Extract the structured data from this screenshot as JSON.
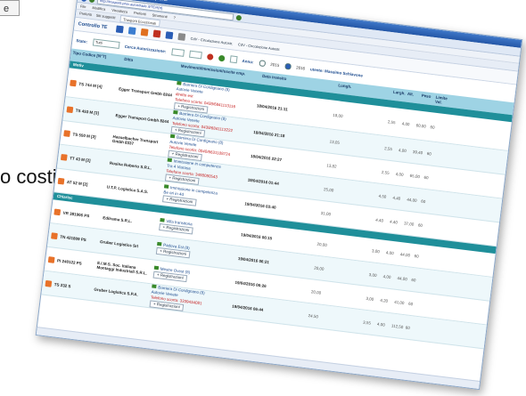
{
  "fragment": {
    "button_label": "e",
    "text": "o costituire"
  },
  "browser": {
    "title": "Trasporti Eccezionali - Internet Explorer",
    "address": "http://trasporti.prov.autostrade.it/TE/#{tr}",
    "menu": [
      "File",
      "Modifica",
      "Visualizza",
      "Preferiti",
      "Strumenti",
      "?"
    ],
    "favorites": [
      "Preferiti",
      "Siti suggeriti",
      "Trasporti Eccezionali"
    ],
    "tab": "Trasporti Eccezionali"
  },
  "app": {
    "title": "Controllo TE",
    "toolbar_links": [
      "CdV - Circolazione Autostr.",
      "CdV - Circolazione Autostr."
    ]
  },
  "filters": {
    "stato_label": "Stato:",
    "stato_value": "Tutti",
    "cerca_label": "Cerca Autorizzazione:",
    "anno_label": "Anno:",
    "anno_options": [
      "2015",
      "2016"
    ],
    "anno_selected": "2016",
    "user_label": "utente: Massimo Schiavone"
  },
  "table": {
    "headers": [
      "Tipo Codice [N°T]",
      "Ditta",
      "Movimenti/Immissioni/uscite cmp.",
      "Data transito",
      "Lungh.",
      "Largh.",
      "Alt.",
      "Peso",
      "Limite Vel."
    ],
    "sections": {
      "first": "Motiv",
      "second": "Chiarisc"
    },
    "rows": [
      {
        "code": "TS 744 M [4]",
        "ditta": "Egger Transport Gmbh 8244",
        "mov1": "Barriera Di Cordignano (8)",
        "mov2": "Autovie Venete",
        "mov3": "diretto est",
        "tel": "Telefono scorta: 0438/6841113116",
        "reg": "+ Registrazioni",
        "date": "18/04/2016 21:11",
        "l": "18,00",
        "w": "2,55",
        "h": "4,00",
        "p": "60,00",
        "v": "60"
      },
      {
        "code": "TS 453 M [3]",
        "ditta": "Egger Transport Gmbh 8244",
        "mov1": "Barriera Di Cordignano (8)",
        "mov2": "Autovie Venete",
        "mov3": "",
        "tel": "Telefono scorta: 0438/6841113222",
        "reg": "+ Registrazioni",
        "date": "18/04/2016 21:18",
        "l": "13,05",
        "w": "2,55",
        "h": "4,00",
        "p": "39,40",
        "v": "60"
      },
      {
        "code": "TS 550 M [2]",
        "ditta": "Hasselbacher Transport Gmbh 8337",
        "mov1": "Barriera Di Cordignano (8)",
        "mov2": "Autovie Venete",
        "mov3": "",
        "tel": "Telefono scorta: 0040/6631108724",
        "reg": "+ Registrazioni",
        "date": "18/04/2016 22:27",
        "l": "13,82",
        "w": "2,55",
        "h": "4,00",
        "p": "65,00",
        "v": "60"
      },
      {
        "code": "TT 43 M [2]",
        "ditta": "Rosina Roberto S.R.L.",
        "mov1": "Immissione in competenza",
        "mov2": "Tra 4 Viarasa",
        "mov3": "",
        "tel": "Telefono scorta: 3498080543",
        "reg": "+ Registrazioni",
        "date": "19/04/2016 01:44",
        "l": "25,00",
        "w": "4,50",
        "h": "4,40",
        "p": "44,00",
        "v": "60"
      },
      {
        "code": "AT 52 M [2]",
        "ditta": "U.T.P. Logistica S.A.S.",
        "mov1": "Immissione in competenza",
        "mov2": "Be ori in 4d",
        "mov3": "",
        "tel": "",
        "reg": "+ Registrazioni",
        "date": "19/04/2016 03:40",
        "l": "31,00",
        "w": "4,40",
        "h": "4,40",
        "p": "37,00",
        "v": "60"
      }
    ],
    "rows2": [
      {
        "code": "VR 381906 PS",
        "ditta": "Edilrama S.R.L.",
        "mov1": "Villa transitoria",
        "mov2": "",
        "tel": "",
        "reg": "+ Registrazioni",
        "date": "19/04/2016 06:15",
        "l": "20,00",
        "w": "3,00",
        "h": "4,00",
        "p": "44,00",
        "v": "60"
      },
      {
        "code": "TN 421809 PS",
        "ditta": "Gruber Logistics Srl",
        "mov1": "Padova Est (8)",
        "mov2": "",
        "tel": "",
        "reg": "+ Registrazioni",
        "date": "19/04/2016 06:21",
        "l": "20,00",
        "w": "3,00",
        "h": "4,00",
        "p": "44,00",
        "v": "60"
      },
      {
        "code": "PI 240122 PS",
        "ditta": "E.I.M.S. Soc. Italiana Montaggi Industriali S.R.L.",
        "mov1": "Mestre Ovest (8)",
        "mov2": "",
        "tel": "",
        "reg": "+ Registrazioni",
        "date": "19/04/2016 06:26",
        "l": "20,00",
        "w": "3,00",
        "h": "4,20",
        "p": "41,00",
        "v": "60"
      },
      {
        "code": "TS 232 S",
        "ditta": "Gruber Logistics S.P.A.",
        "mov1": "Barriera Di Cordignano (8)",
        "mov2": "Autovie Venete",
        "mov3": "",
        "tel": "Telefono scorta: 3339434081",
        "reg": "+ Registrazioni",
        "date": "19/04/2016 06:44",
        "l": "24,50",
        "w": "3,55",
        "h": "4,00",
        "p": "112,50",
        "v": "60"
      }
    ]
  }
}
